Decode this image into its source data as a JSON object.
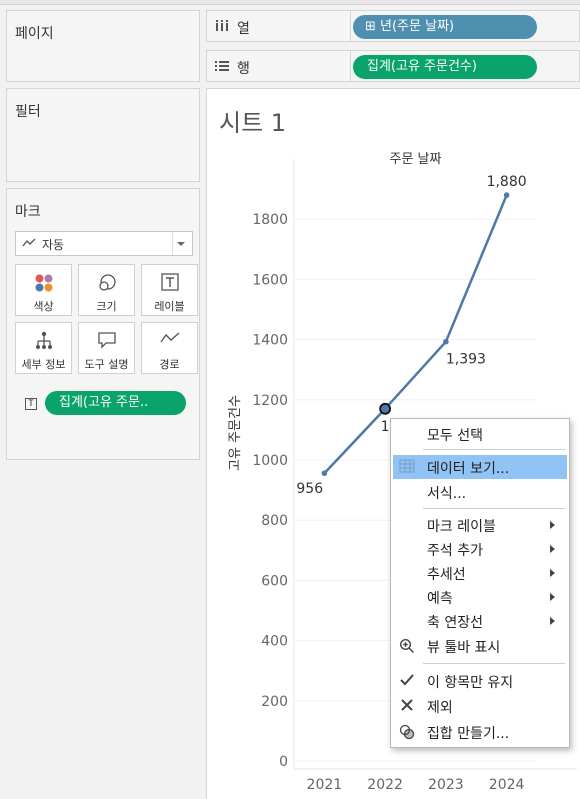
{
  "left_panel": {
    "pages_title": "페이지",
    "filters_title": "필터",
    "marks_title": "마크",
    "mark_type": "자동",
    "mark_buttons": {
      "color": "색상",
      "size": "크기",
      "label": "레이블",
      "detail": "세부 정보",
      "tooltip": "도구 설명",
      "path": "경로"
    },
    "mark_pill": "집계(고유 주문.."
  },
  "shelves": {
    "columns_label": "열",
    "columns_pill": "⊞ 년(주문 날짜)",
    "rows_label": "행",
    "rows_pill": "집계(고유 주문건수)"
  },
  "sheet": {
    "title": "시트 1"
  },
  "chart_data": {
    "type": "line",
    "title": "주문 날짜",
    "xlabel": "",
    "ylabel": "고유 주문건수",
    "categories": [
      "2021",
      "2022",
      "2023",
      "2024"
    ],
    "values": [
      956,
      1170,
      1393,
      1880
    ],
    "data_labels": [
      "956",
      "1",
      "1,393",
      "1,880"
    ],
    "yticks": [
      "0",
      "200",
      "400",
      "600",
      "800",
      "1000",
      "1200",
      "1400",
      "1600",
      "1800"
    ],
    "ylim": [
      0,
      1980
    ],
    "grid": "horizontal",
    "selected_point": "2022",
    "line_color": "#4e79a7"
  },
  "context_menu": {
    "items": [
      {
        "label": "모두 선택"
      },
      {
        "label": "데이터 보기..."
      },
      {
        "label": "서식..."
      },
      {
        "label": "마크 레이블"
      },
      {
        "label": "주석 추가"
      },
      {
        "label": "추세선"
      },
      {
        "label": "예측"
      },
      {
        "label": "축 연장선"
      },
      {
        "label": "뷰 툴바 표시"
      },
      {
        "label": "이 항목만 유지"
      },
      {
        "label": "제외"
      },
      {
        "label": "집합 만들기..."
      }
    ],
    "highlight_color": "#92c3f5"
  }
}
